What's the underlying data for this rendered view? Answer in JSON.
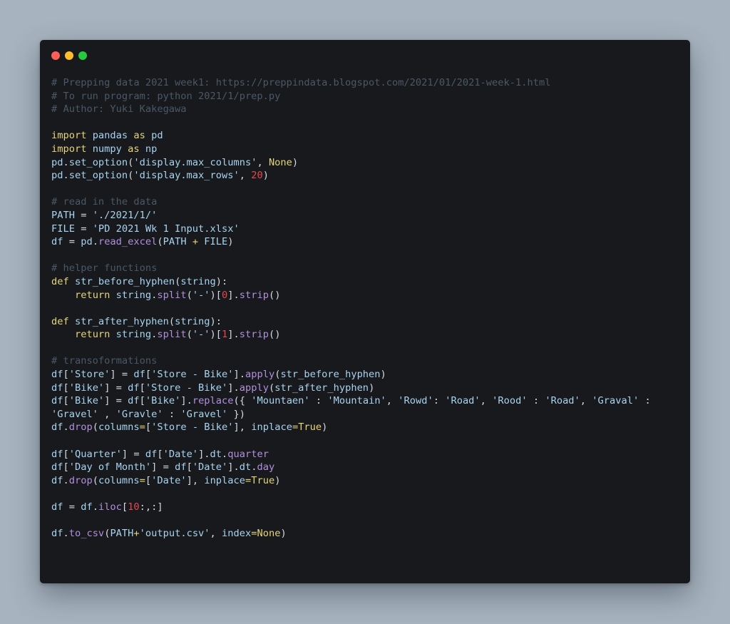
{
  "window": {
    "controls": [
      {
        "name": "close-button",
        "color": "#ff5f56"
      },
      {
        "name": "minimize-button",
        "color": "#ffbd2e"
      },
      {
        "name": "zoom-button",
        "color": "#27c93f"
      }
    ]
  },
  "code_lines": [
    [
      [
        "c",
        "# Prepping data 2021 week1: https://preppindata.blogspot.com/2021/01/2021-week-1.html"
      ]
    ],
    [
      [
        "c",
        "# To run program: python 2021/1/prep.py"
      ]
    ],
    [
      [
        "c",
        "# Author: Yuki Kakegawa"
      ]
    ],
    [],
    [
      [
        "k",
        "import"
      ],
      [
        "i",
        " pandas "
      ],
      [
        "k",
        "as"
      ],
      [
        "i",
        " pd"
      ]
    ],
    [
      [
        "k",
        "import"
      ],
      [
        "i",
        " numpy "
      ],
      [
        "k",
        "as"
      ],
      [
        "i",
        " np"
      ]
    ],
    [
      [
        "i",
        "pd"
      ],
      [
        "p",
        "."
      ],
      [
        "i",
        "set_option"
      ],
      [
        "p",
        "("
      ],
      [
        "s",
        "'display.max_columns'"
      ],
      [
        "p",
        ", "
      ],
      [
        "n",
        "None"
      ],
      [
        "p",
        ")"
      ]
    ],
    [
      [
        "i",
        "pd"
      ],
      [
        "p",
        "."
      ],
      [
        "i",
        "set_option"
      ],
      [
        "p",
        "("
      ],
      [
        "s",
        "'display.max_rows'"
      ],
      [
        "p",
        ", "
      ],
      [
        "d",
        "20"
      ],
      [
        "p",
        ")"
      ]
    ],
    [],
    [
      [
        "c",
        "# read in the data"
      ]
    ],
    [
      [
        "i",
        "PATH "
      ],
      [
        "p",
        "= "
      ],
      [
        "s",
        "'./2021/1/'"
      ]
    ],
    [
      [
        "i",
        "FILE "
      ],
      [
        "p",
        "= "
      ],
      [
        "s",
        "'PD 2021 Wk 1 Input.xlsx'"
      ]
    ],
    [
      [
        "i",
        "df "
      ],
      [
        "p",
        "= "
      ],
      [
        "i",
        "pd"
      ],
      [
        "p",
        "."
      ],
      [
        "f",
        "read_excel"
      ],
      [
        "p",
        "("
      ],
      [
        "i",
        "PATH "
      ],
      [
        "o",
        "+"
      ],
      [
        "i",
        " FILE"
      ],
      [
        "p",
        ")"
      ]
    ],
    [],
    [
      [
        "c",
        "# helper functions"
      ]
    ],
    [
      [
        "k",
        "def"
      ],
      [
        "i",
        " str_before_hyphen"
      ],
      [
        "p",
        "("
      ],
      [
        "i",
        "string"
      ],
      [
        "p",
        "):"
      ]
    ],
    [
      [
        "i",
        "    "
      ],
      [
        "k",
        "return"
      ],
      [
        "i",
        " string"
      ],
      [
        "p",
        "."
      ],
      [
        "f",
        "split"
      ],
      [
        "p",
        "("
      ],
      [
        "s",
        "'-'"
      ],
      [
        "p",
        ")["
      ],
      [
        "d",
        "0"
      ],
      [
        "p",
        "]."
      ],
      [
        "f",
        "strip"
      ],
      [
        "p",
        "()"
      ]
    ],
    [],
    [
      [
        "k",
        "def"
      ],
      [
        "i",
        " str_after_hyphen"
      ],
      [
        "p",
        "("
      ],
      [
        "i",
        "string"
      ],
      [
        "p",
        "):"
      ]
    ],
    [
      [
        "i",
        "    "
      ],
      [
        "k",
        "return"
      ],
      [
        "i",
        " string"
      ],
      [
        "p",
        "."
      ],
      [
        "f",
        "split"
      ],
      [
        "p",
        "("
      ],
      [
        "s",
        "'-'"
      ],
      [
        "p",
        ")["
      ],
      [
        "d",
        "1"
      ],
      [
        "p",
        "]."
      ],
      [
        "f",
        "strip"
      ],
      [
        "p",
        "()"
      ]
    ],
    [],
    [
      [
        "c",
        "# transoformations"
      ]
    ],
    [
      [
        "i",
        "df"
      ],
      [
        "p",
        "["
      ],
      [
        "s",
        "'Store'"
      ],
      [
        "p",
        "] = "
      ],
      [
        "i",
        "df"
      ],
      [
        "p",
        "["
      ],
      [
        "s",
        "'Store - Bike'"
      ],
      [
        "p",
        "]."
      ],
      [
        "f",
        "apply"
      ],
      [
        "p",
        "("
      ],
      [
        "i",
        "str_before_hyphen"
      ],
      [
        "p",
        ")"
      ]
    ],
    [
      [
        "i",
        "df"
      ],
      [
        "p",
        "["
      ],
      [
        "s",
        "'Bike'"
      ],
      [
        "p",
        "] = "
      ],
      [
        "i",
        "df"
      ],
      [
        "p",
        "["
      ],
      [
        "s",
        "'Store - Bike'"
      ],
      [
        "p",
        "]."
      ],
      [
        "f",
        "apply"
      ],
      [
        "p",
        "("
      ],
      [
        "i",
        "str_after_hyphen"
      ],
      [
        "p",
        ")"
      ]
    ],
    [
      [
        "i",
        "df"
      ],
      [
        "p",
        "["
      ],
      [
        "s",
        "'Bike'"
      ],
      [
        "p",
        "] = "
      ],
      [
        "i",
        "df"
      ],
      [
        "p",
        "["
      ],
      [
        "s",
        "'Bike'"
      ],
      [
        "p",
        "]."
      ],
      [
        "f",
        "replace"
      ],
      [
        "p",
        "({ "
      ],
      [
        "s",
        "'Mountaen'"
      ],
      [
        "p",
        " : "
      ],
      [
        "s",
        "'Mountain'"
      ],
      [
        "p",
        ", "
      ],
      [
        "s",
        "'Rowd'"
      ],
      [
        "p",
        ": "
      ],
      [
        "s",
        "'Road'"
      ],
      [
        "p",
        ", "
      ],
      [
        "s",
        "'Rood'"
      ],
      [
        "p",
        " : "
      ],
      [
        "s",
        "'Road'"
      ],
      [
        "p",
        ", "
      ],
      [
        "s",
        "'Graval'"
      ],
      [
        "p",
        " :"
      ]
    ],
    [
      [
        "s",
        "'Gravel'"
      ],
      [
        "p",
        " , "
      ],
      [
        "s",
        "'Gravle'"
      ],
      [
        "p",
        " : "
      ],
      [
        "s",
        "'Gravel'"
      ],
      [
        "p",
        " })"
      ]
    ],
    [
      [
        "i",
        "df"
      ],
      [
        "p",
        "."
      ],
      [
        "f",
        "drop"
      ],
      [
        "p",
        "("
      ],
      [
        "i",
        "columns"
      ],
      [
        "o",
        "="
      ],
      [
        "p",
        "["
      ],
      [
        "s",
        "'Store - Bike'"
      ],
      [
        "p",
        "], "
      ],
      [
        "i",
        "inplace"
      ],
      [
        "o",
        "="
      ],
      [
        "n",
        "True"
      ],
      [
        "p",
        ")"
      ]
    ],
    [],
    [
      [
        "i",
        "df"
      ],
      [
        "p",
        "["
      ],
      [
        "s",
        "'Quarter'"
      ],
      [
        "p",
        "] = "
      ],
      [
        "i",
        "df"
      ],
      [
        "p",
        "["
      ],
      [
        "s",
        "'Date'"
      ],
      [
        "p",
        "]."
      ],
      [
        "i",
        "dt"
      ],
      [
        "p",
        "."
      ],
      [
        "f",
        "quarter"
      ]
    ],
    [
      [
        "i",
        "df"
      ],
      [
        "p",
        "["
      ],
      [
        "s",
        "'Day of Month'"
      ],
      [
        "p",
        "] = "
      ],
      [
        "i",
        "df"
      ],
      [
        "p",
        "["
      ],
      [
        "s",
        "'Date'"
      ],
      [
        "p",
        "]."
      ],
      [
        "i",
        "dt"
      ],
      [
        "p",
        "."
      ],
      [
        "f",
        "day"
      ]
    ],
    [
      [
        "i",
        "df"
      ],
      [
        "p",
        "."
      ],
      [
        "f",
        "drop"
      ],
      [
        "p",
        "("
      ],
      [
        "i",
        "columns"
      ],
      [
        "o",
        "="
      ],
      [
        "p",
        "["
      ],
      [
        "s",
        "'Date'"
      ],
      [
        "p",
        "], "
      ],
      [
        "i",
        "inplace"
      ],
      [
        "o",
        "="
      ],
      [
        "n",
        "True"
      ],
      [
        "p",
        ")"
      ]
    ],
    [],
    [
      [
        "i",
        "df "
      ],
      [
        "p",
        "= "
      ],
      [
        "i",
        "df"
      ],
      [
        "p",
        "."
      ],
      [
        "f",
        "iloc"
      ],
      [
        "p",
        "["
      ],
      [
        "d",
        "10"
      ],
      [
        "p",
        ":,:]"
      ]
    ],
    [],
    [
      [
        "i",
        "df"
      ],
      [
        "p",
        "."
      ],
      [
        "f",
        "to_csv"
      ],
      [
        "p",
        "("
      ],
      [
        "i",
        "PATH"
      ],
      [
        "o",
        "+"
      ],
      [
        "s",
        "'output.csv'"
      ],
      [
        "p",
        ", "
      ],
      [
        "i",
        "index"
      ],
      [
        "o",
        "="
      ],
      [
        "n",
        "None"
      ],
      [
        "p",
        ")"
      ]
    ]
  ]
}
